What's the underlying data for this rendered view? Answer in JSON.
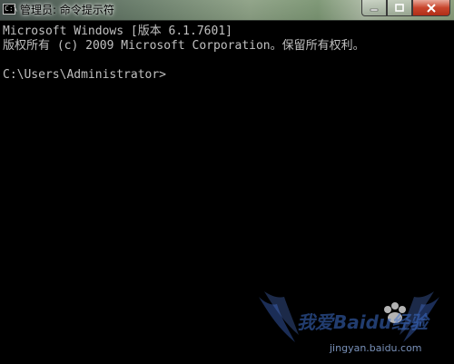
{
  "window": {
    "title": "管理员: 命令提示符",
    "app_icon": "command-prompt-icon",
    "controls": {
      "minimize_icon": "minimize-icon",
      "maximize_icon": "maximize-icon",
      "close_icon": "close-icon"
    }
  },
  "console": {
    "lines": [
      "Microsoft Windows [版本 6.1.7601]",
      "版权所有 (c) 2009 Microsoft Corporation。保留所有权利。",
      "",
      "C:\\Users\\Administrator>"
    ]
  },
  "watermark": {
    "main_text": "我爱Baidu经验",
    "sub_text": "jingyan.baidu.com"
  }
}
